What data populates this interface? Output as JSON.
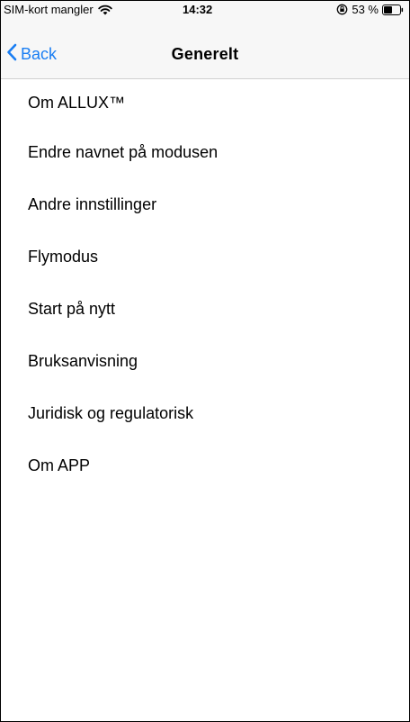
{
  "status_bar": {
    "carrier": "SIM-kort mangler",
    "time": "14:32",
    "battery_percent": "53 %",
    "battery_level": 0.53
  },
  "nav": {
    "back_label": "Back",
    "title": "Generelt"
  },
  "menu": {
    "items": [
      {
        "label": "Om ALLUX™"
      },
      {
        "label": "Endre navnet på modusen"
      },
      {
        "label": "Andre innstillinger"
      },
      {
        "label": "Flymodus"
      },
      {
        "label": "Start på nytt"
      },
      {
        "label": "Bruksanvisning"
      },
      {
        "label": "Juridisk og regulatorisk"
      },
      {
        "label": "Om APP"
      }
    ]
  },
  "colors": {
    "accent": "#1a7ef3",
    "bar_background": "#f7f7f7"
  }
}
